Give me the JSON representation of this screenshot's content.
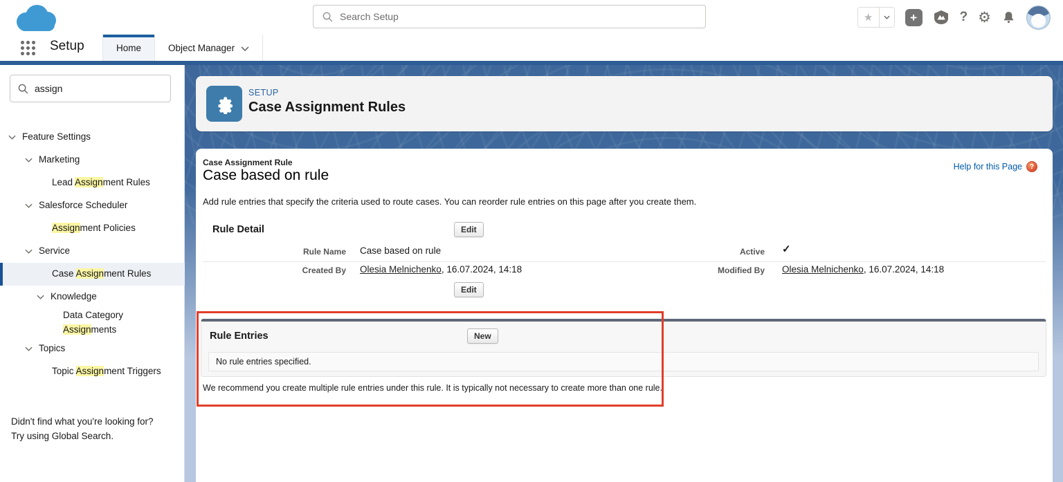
{
  "colors": {
    "brand_line": "#2e5c94",
    "banner_blue": "#3e689b",
    "active_tab_bar": "#1b5f9e",
    "selected_item_bar": "#1b5297",
    "highlight_yellow": "#fbf6a4",
    "link_blue": "#015ba7",
    "annotation_red": "#e03f2b",
    "section_top_bar": "#5f6876",
    "header_tile_blue": "#3d7cab",
    "logo_blue": "#3f9ad3"
  },
  "global_header": {
    "search_placeholder": "Search Setup",
    "icons": [
      "search-icon",
      "favorites-star-icon",
      "favorites-caret-icon",
      "quick-add-icon",
      "guidance-center-icon",
      "help-icon",
      "setup-gear-icon",
      "notifications-bell-icon",
      "user-avatar"
    ]
  },
  "nav_bar": {
    "app_name": "Setup",
    "tabs": [
      {
        "label": "Home",
        "active": true
      },
      {
        "label": "Object Manager",
        "active": false
      }
    ]
  },
  "sidebar": {
    "search_value": "assign",
    "tree": [
      {
        "name": "feature-settings",
        "pad": 12,
        "chevron": true,
        "parts": [
          {
            "t": "Feature Settings"
          }
        ]
      },
      {
        "name": "marketing",
        "pad": 36,
        "chevron": true,
        "parts": [
          {
            "t": "Marketing"
          }
        ]
      },
      {
        "name": "lead-assignment-rules",
        "pad": 75,
        "chevron": false,
        "parts": [
          {
            "t": "Lead "
          },
          {
            "t": "Assign",
            "hl": true
          },
          {
            "t": "ment Rules"
          }
        ]
      },
      {
        "name": "salesforce-scheduler",
        "pad": 36,
        "chevron": true,
        "parts": [
          {
            "t": "Salesforce Scheduler"
          }
        ]
      },
      {
        "name": "assignment-policies",
        "pad": 75,
        "chevron": false,
        "parts": [
          {
            "t": "Assign",
            "hl": true
          },
          {
            "t": "ment Policies"
          }
        ]
      },
      {
        "name": "service",
        "pad": 36,
        "chevron": true,
        "parts": [
          {
            "t": "Service"
          }
        ]
      },
      {
        "name": "case-assignment-rules",
        "pad": 75,
        "chevron": false,
        "selected": true,
        "parts": [
          {
            "t": "Case "
          },
          {
            "t": "Assign",
            "hl": true
          },
          {
            "t": "ment Rules"
          }
        ]
      },
      {
        "name": "knowledge",
        "pad": 53,
        "chevron": true,
        "parts": [
          {
            "t": "Knowledge"
          }
        ]
      },
      {
        "name": "data-category-assignments",
        "pad": 91,
        "chevron": false,
        "narrow": true,
        "parts": [
          {
            "t": "Data Category "
          },
          {
            "t": "Assign",
            "hl": true
          },
          {
            "t": "ments"
          }
        ]
      },
      {
        "name": "topics",
        "pad": 36,
        "chevron": true,
        "parts": [
          {
            "t": "Topics"
          }
        ]
      },
      {
        "name": "topic-assignment-triggers",
        "pad": 75,
        "chevron": false,
        "parts": [
          {
            "t": "Topic "
          },
          {
            "t": "Assign",
            "hl": true
          },
          {
            "t": "ment Triggers"
          }
        ]
      }
    ],
    "footer_line1": "Didn't find what you're looking for?",
    "footer_line2": "Try using Global Search."
  },
  "page_header": {
    "eyebrow": "SETUP",
    "title": "Case Assignment Rules"
  },
  "content": {
    "entity_label": "Case Assignment Rule",
    "record_title": "Case based on rule",
    "help_link": "Help for this Page",
    "description": "Add rule entries that specify the criteria used to route cases. You can reorder rule entries on this page after you create them.",
    "rule_detail": {
      "section_title": "Rule Detail",
      "edit_button": "Edit",
      "fields": {
        "rule_name_label": "Rule Name",
        "rule_name_value": "Case based on rule",
        "active_label": "Active",
        "active_value": "✓",
        "created_by_label": "Created By",
        "created_by_link": "Olesia Melnichenko",
        "created_by_suffix": ", 16.07.2024, 14:18",
        "modified_by_label": "Modified By",
        "modified_by_link": "Olesia Melnichenko",
        "modified_by_suffix": ", 16.07.2024, 14:18"
      }
    },
    "rule_entries": {
      "section_title": "Rule Entries",
      "new_button": "New",
      "empty_message": "No rule entries specified.",
      "recommendation": "We recommend you create multiple rule entries under this rule. It is typically not necessary to create more than one rule."
    }
  }
}
